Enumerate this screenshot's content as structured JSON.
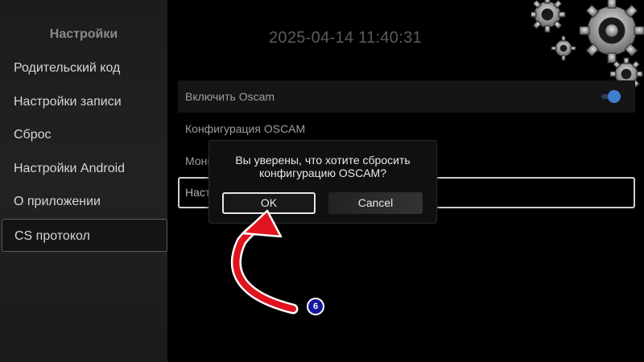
{
  "sidebar": {
    "title": "Настройки",
    "items": [
      {
        "label": "Родительский код"
      },
      {
        "label": "Настройки записи"
      },
      {
        "label": "Сброс"
      },
      {
        "label": "Настройки Android"
      },
      {
        "label": "О приложении"
      },
      {
        "label": "CS протокол"
      }
    ],
    "selected_index": 5
  },
  "header": {
    "clock": "2025-04-14 11:40:31",
    "decoration_icon": "gears-icon"
  },
  "settings": {
    "rows": [
      {
        "label": "Включить Oscam",
        "toggle_on": true
      },
      {
        "label": "Конфигурация OSCAM"
      },
      {
        "label": "Мони"
      },
      {
        "label": "Наст"
      }
    ]
  },
  "dialog": {
    "message_line1": "Вы уверены, что хотите сбросить",
    "message_line2": "конфигурацию OSCAM?",
    "ok_label": "OK",
    "cancel_label": "Cancel"
  },
  "annotation": {
    "step_number": "6",
    "arrow_color": "#e0141e",
    "badge_color": "#16169c"
  },
  "colors": {
    "accent": "#3f7fd1",
    "background": "#000000"
  }
}
